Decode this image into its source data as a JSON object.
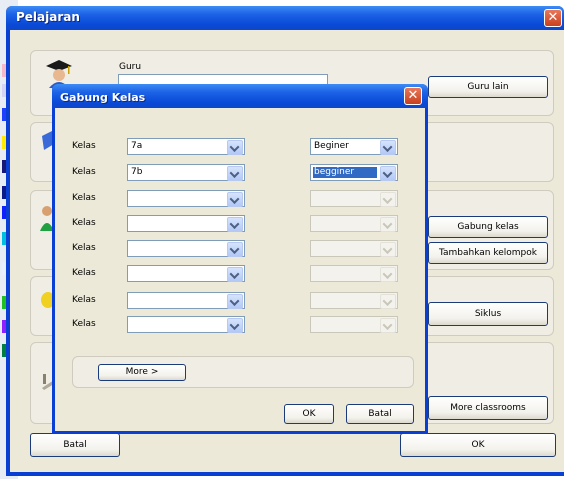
{
  "outer": {
    "title": "Pelajaran",
    "guru_label": "Guru",
    "guru_lain": "Guru lain",
    "gabung_kelas": "Gabung kelas",
    "tambahkan_kelompok": "Tambahkan kelompok",
    "siklus": "Siklus",
    "more_classrooms": "More classrooms",
    "batal": "Batal",
    "ok": "OK",
    "close_glyph": "✕"
  },
  "dialog": {
    "title": "Gabung Kelas",
    "close_glyph": "✕",
    "rows": [
      {
        "label": "Kelas",
        "kelas": "7a",
        "level": "Beginer",
        "level_enabled": true,
        "level_selected": false
      },
      {
        "label": "Kelas",
        "kelas": "7b",
        "level": "begginer",
        "level_enabled": true,
        "level_selected": true
      },
      {
        "label": "Kelas",
        "kelas": "",
        "level": "",
        "level_enabled": false,
        "level_selected": false
      },
      {
        "label": "Kelas",
        "kelas": "",
        "level": "",
        "level_enabled": false,
        "level_selected": false
      },
      {
        "label": "Kelas",
        "kelas": "",
        "level": "",
        "level_enabled": false,
        "level_selected": false
      },
      {
        "label": "Kelas",
        "kelas": "",
        "level": "",
        "level_enabled": false,
        "level_selected": false
      },
      {
        "label": "Kelas",
        "kelas": "",
        "level": "",
        "level_enabled": false,
        "level_selected": false
      },
      {
        "label": "Kelas",
        "kelas": "",
        "level": "",
        "level_enabled": false,
        "level_selected": false
      }
    ],
    "more": "More >",
    "ok": "OK",
    "batal": "Batal"
  },
  "side_strip_colors": [
    "#f4b8c8",
    "#d4d4f4",
    "#2040ff",
    "#ffea00",
    "#181878",
    "#0c1a8a",
    "#1020ff",
    "#00c0e0",
    "#e8f0ff",
    "#20c020",
    "#9020ff",
    "#008040"
  ],
  "accent": "#0a4ad8"
}
